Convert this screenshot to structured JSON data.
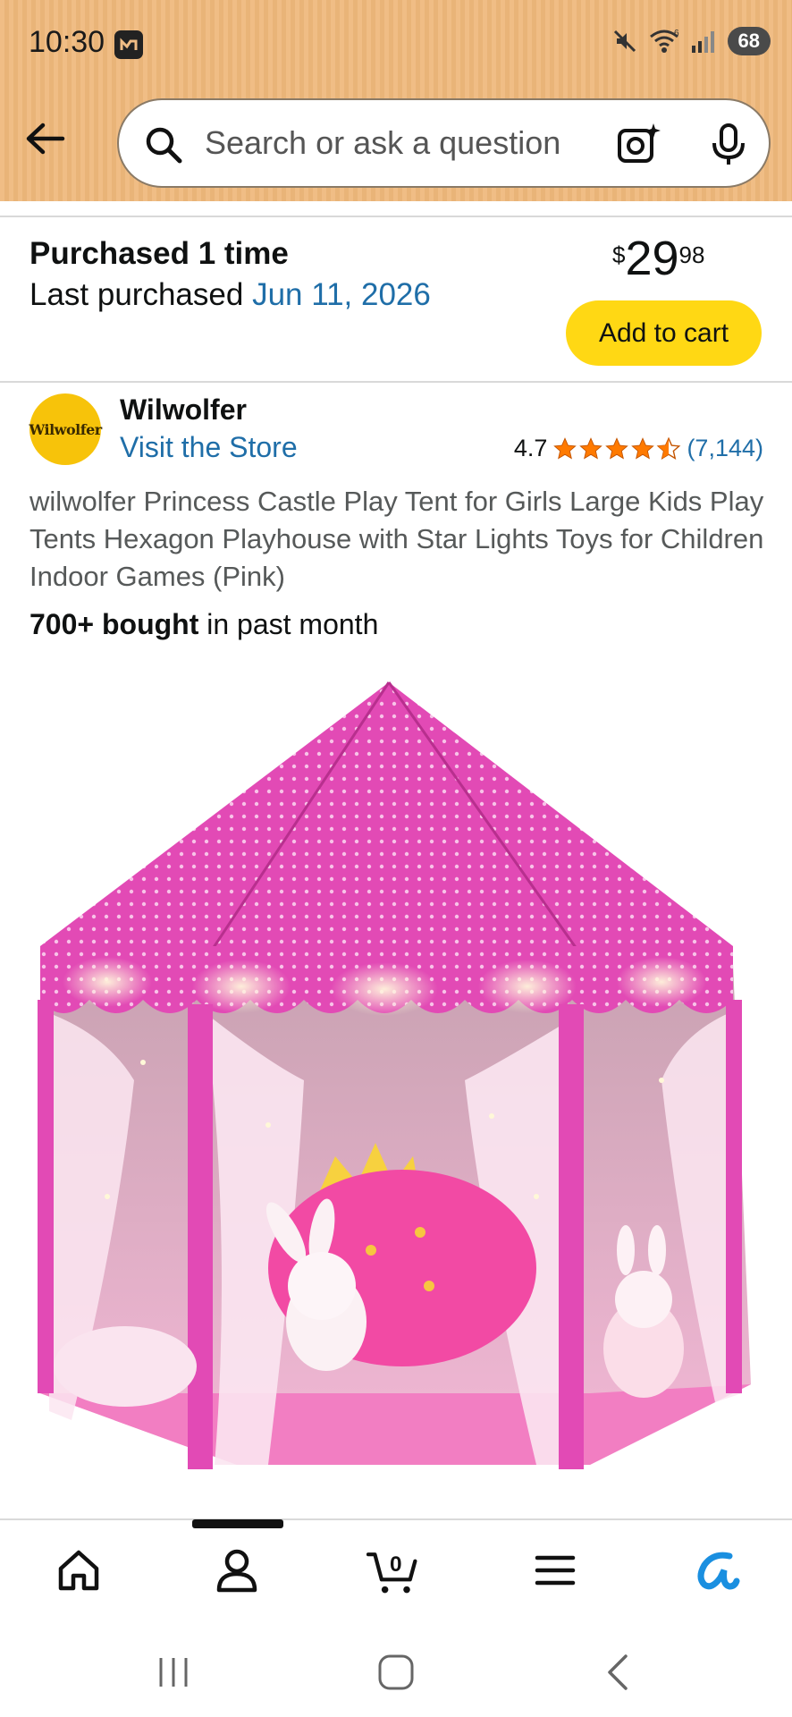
{
  "status_bar": {
    "time": "10:30",
    "battery": "68",
    "wifi_label": "6"
  },
  "header": {
    "search_placeholder": "Search or ask a question"
  },
  "purchase": {
    "purchased_text": "Purchased 1 time",
    "last_label": "Last purchased",
    "last_date": "Jun 11, 2026",
    "price_currency": "$",
    "price_whole": "29",
    "price_fraction": "98",
    "add_to_cart": "Add to cart"
  },
  "store": {
    "logo_text": "Wilwolfer",
    "brand": "Wilwolfer",
    "visit_label": "Visit the Store",
    "rating_value": "4.7",
    "rating_stars": 4.7,
    "rating_count": "(7,144)"
  },
  "product": {
    "title": "wilwolfer Princess Castle Play Tent for Girls Large Kids Play Tents Hexagon Playhouse with Star Lights Toys for Children Indoor Games (Pink)",
    "bought_bold": "700+ bought",
    "bought_rest": " in past month"
  },
  "bottom_nav": {
    "items": [
      "home-icon",
      "account-icon",
      "cart-icon",
      "menu-icon",
      "rufus-icon"
    ],
    "cart_count": "0"
  },
  "colors": {
    "accent_link": "#1f6ea8",
    "cart_button": "#ffd814",
    "star": "#ff7a00",
    "header": "#f0bd85"
  }
}
